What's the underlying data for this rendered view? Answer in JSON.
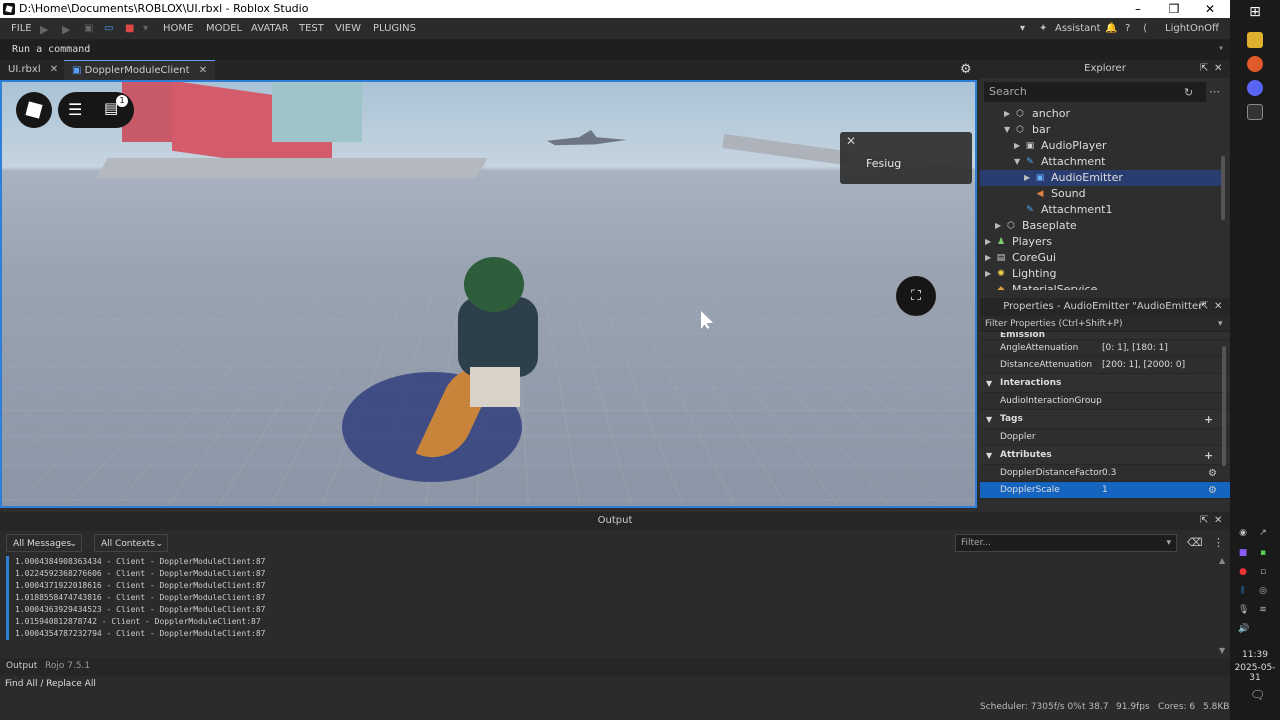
{
  "window": {
    "title": "D:\\Home\\Documents\\ROBLOX\\UI.rbxl - Roblox Studio"
  },
  "menu": {
    "file": "FILE",
    "items": [
      "HOME",
      "MODEL",
      "AVATAR",
      "TEST",
      "VIEW",
      "PLUGINS"
    ],
    "assistant": "Assistant",
    "user": "LightOnOff"
  },
  "command_bar": {
    "placeholder": "Run a command"
  },
  "tabs": [
    {
      "label": "UI.rbxl"
    },
    {
      "label": "DopplerModuleClient"
    }
  ],
  "viewport": {
    "toast_text": "Fesiug",
    "notification_count": "1"
  },
  "explorer": {
    "title": "Explorer",
    "search_placeholder": "Search",
    "items": [
      {
        "label": "anchor",
        "icon": "part-icon"
      },
      {
        "label": "bar",
        "icon": "part-icon"
      },
      {
        "label": "AudioPlayer",
        "icon": "audio-player-icon"
      },
      {
        "label": "Attachment",
        "icon": "attachment-icon"
      },
      {
        "label": "AudioEmitter",
        "icon": "audio-emitter-icon"
      },
      {
        "label": "Sound",
        "icon": "sound-icon"
      },
      {
        "label": "Attachment1",
        "icon": "attachment-icon"
      },
      {
        "label": "Baseplate",
        "icon": "part-icon"
      },
      {
        "label": "Players",
        "icon": "players-icon"
      },
      {
        "label": "CoreGui",
        "icon": "coregui-icon"
      },
      {
        "label": "Lighting",
        "icon": "lighting-icon"
      },
      {
        "label": "MaterialService",
        "icon": "material-icon"
      }
    ]
  },
  "properties": {
    "title": "Properties - AudioEmitter \"AudioEmitter\"",
    "filter_placeholder": "Filter Properties (Ctrl+Shift+P)",
    "emission_label": "Emission",
    "angle_attenuation": {
      "name": "AngleAttenuation",
      "value": "[0: 1], [180: 1]"
    },
    "distance_attenuation": {
      "name": "DistanceAttenuation",
      "value": "[200: 1], [2000: 0]"
    },
    "interactions_label": "Interactions",
    "audio_interaction_group": "AudioInteractionGroup",
    "tags_label": "Tags",
    "tag_value": "Doppler",
    "attributes_label": "Attributes",
    "doppler_distance_factor": {
      "name": "DopplerDistanceFactor",
      "value": "0.3"
    },
    "doppler_scale": {
      "name": "DopplerScale",
      "value": "1"
    }
  },
  "output": {
    "title": "Output",
    "messages_filter": "All Messages",
    "contexts_filter": "All Contexts",
    "filter_placeholder": "Filter...",
    "lines": [
      "1.0004384908363434  -  Client - DopplerModuleClient:87",
      "1.0224592368276606  -  Client - DopplerModuleClient:87",
      "1.0004371922018616  -  Client - DopplerModuleClient:87",
      "1.0188558474743816  -  Client - DopplerModuleClient:87",
      "1.0004363929434523  -  Client - DopplerModuleClient:87",
      "1.015940812878742  -  Client - DopplerModuleClient:87",
      "1.0004354787232794  -  Client - DopplerModuleClient:87"
    ]
  },
  "bottom_tabs": {
    "output": "Output",
    "rojo": "Rojo 7.5.1"
  },
  "find_bar": {
    "label": "Find All / Replace All"
  },
  "status": {
    "scheduler": "Scheduler: 7305f/s 0%",
    "time": "t 38.7",
    "fps": "91.9fps",
    "cores": "Cores: 6",
    "memory": "5.8KB"
  },
  "clock": {
    "time": "11:39",
    "date": "2025-05-31"
  }
}
